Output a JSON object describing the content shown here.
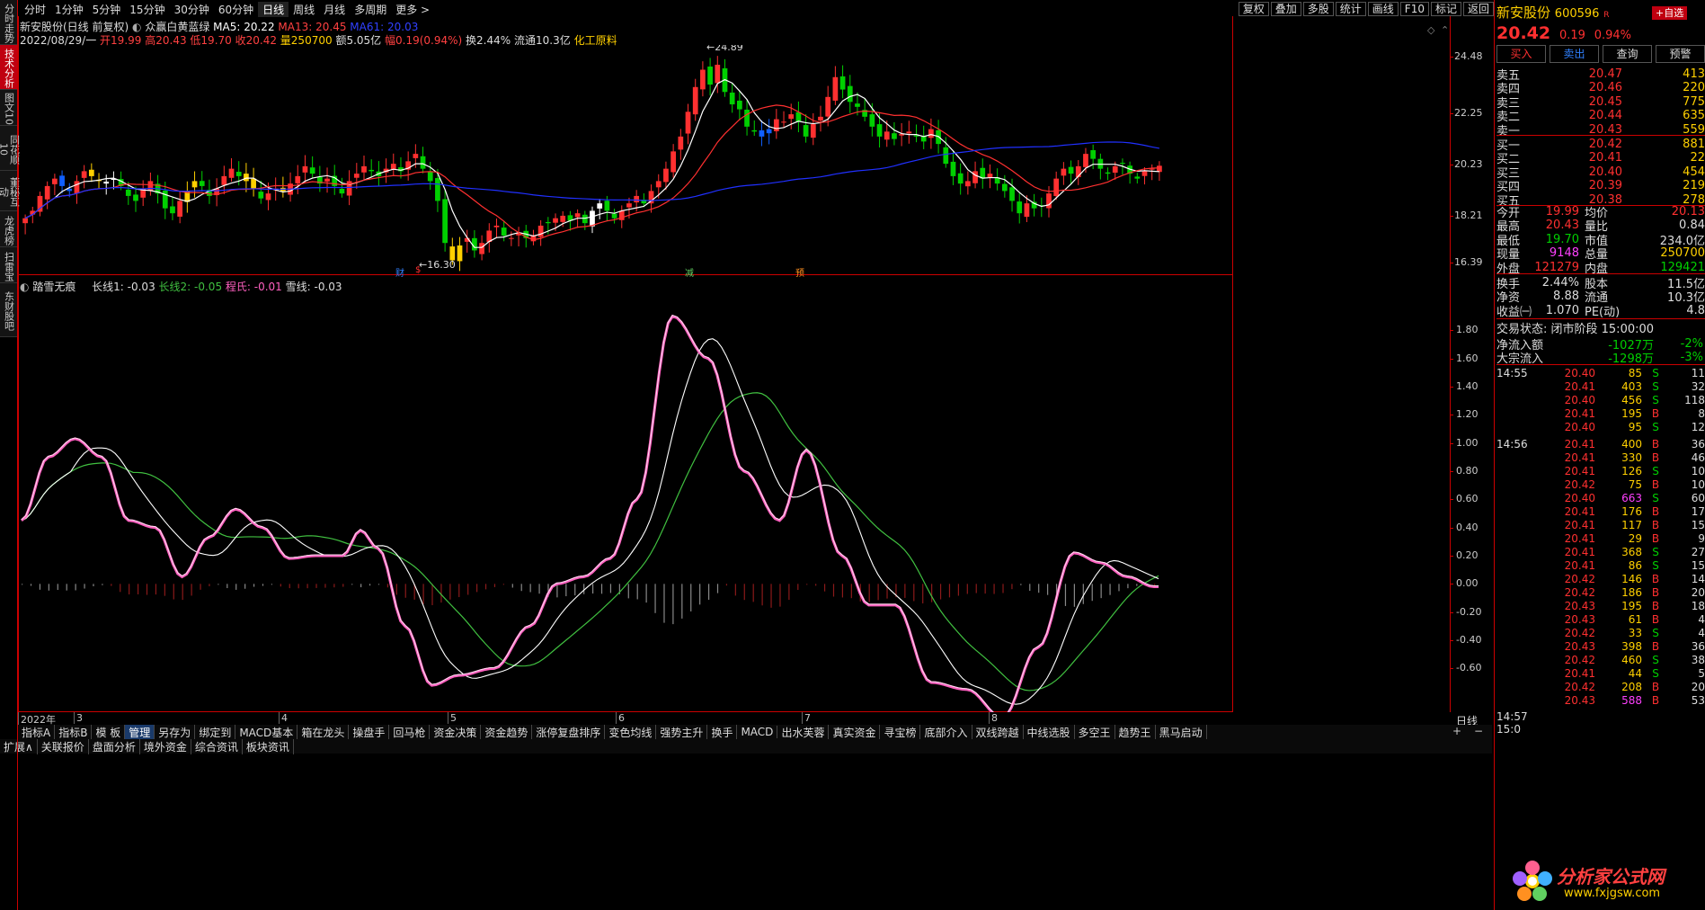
{
  "sidebar": [
    "分时走势",
    "技术分析",
    "图文10",
    "同花顺10",
    "董秘互动",
    "龙虎榜",
    "扫雷宝",
    "东财股吧"
  ],
  "periods": [
    "分时",
    "1分钟",
    "5分钟",
    "15分钟",
    "30分钟",
    "60分钟",
    "日线",
    "周线",
    "月线",
    "多周期",
    "更多"
  ],
  "period_selected": "日线",
  "tools": [
    "复权",
    "叠加",
    "多股",
    "统计",
    "画线",
    "F10",
    "标记",
    "返回"
  ],
  "main_legend": {
    "stock": "新安股份(日线 前复权)",
    "indicator": "众赢白黄蓝绿",
    "ma5": "MA5: 20.22",
    "ma13": "MA13: 20.45",
    "ma61": "MA61: 20.03"
  },
  "day_info": {
    "date": "2022/08/29/一",
    "open": "开19.99",
    "high": "高20.43",
    "low": "低19.70",
    "close": "收20.42",
    "vol": "量250700",
    "amt": "额5.05亿",
    "chg": "幅0.19(0.94%)",
    "turn": "换2.44%",
    "float": "流通10.3亿",
    "sector": "化工原料"
  },
  "price_axis": [
    "24.48",
    "22.25",
    "20.23",
    "18.21",
    "16.39"
  ],
  "price_labels": {
    "high": "24.89",
    "low": "16.30"
  },
  "event_marks": [
    "财",
    "减",
    "预"
  ],
  "sub_legend": {
    "name": "踏雪无痕",
    "l1": "长线1: -0.03",
    "l2": "长线2: -0.05",
    "ch": "程氏: -0.01",
    "xue": "雪线: -0.03"
  },
  "sub_axis": [
    "1.80",
    "1.60",
    "1.40",
    "1.20",
    "1.00",
    "0.80",
    "0.60",
    "0.40",
    "0.20",
    "0.00",
    "-0.20",
    "-0.40",
    "-0.60"
  ],
  "date_axis": [
    "2022年",
    "3",
    "4",
    "5",
    "6",
    "7",
    "8"
  ],
  "period_label": "日线",
  "bottom_tabs": [
    "指标A",
    "指标B",
    "模 板",
    "管理",
    "另存为",
    "绑定到",
    "MACD基本",
    "箱在龙头",
    "操盘手",
    "回马枪",
    "资金决策",
    "资金趋势",
    "涨停复盘排序",
    "变色均线",
    "强势主升",
    "换手",
    "MACD",
    "出水芙蓉",
    "真实资金",
    "寻宝榜",
    "底部介入",
    "双线跨越",
    "中线选股",
    "多空王",
    "趋势王",
    "黑马启动"
  ],
  "bottom_tabs2": [
    "扩展∧",
    "关联报价",
    "盘面分析",
    "境外资金",
    "综合资讯",
    "板块资讯"
  ],
  "quote": {
    "name": "新安股份",
    "code": "600596",
    "code_badge": "R",
    "add": "+自选",
    "price": "20.42",
    "change": "0.19",
    "pct": "0.94%",
    "buttons": [
      "买入",
      "卖出",
      "查询",
      "预警"
    ],
    "asks": [
      {
        "label": "卖五",
        "price": "20.47",
        "vol": "413"
      },
      {
        "label": "卖四",
        "price": "20.46",
        "vol": "220"
      },
      {
        "label": "卖三",
        "price": "20.45",
        "vol": "775"
      },
      {
        "label": "卖二",
        "price": "20.44",
        "vol": "635"
      },
      {
        "label": "卖一",
        "price": "20.43",
        "vol": "559"
      }
    ],
    "bids": [
      {
        "label": "买一",
        "price": "20.42",
        "vol": "881"
      },
      {
        "label": "买二",
        "price": "20.41",
        "vol": "22"
      },
      {
        "label": "买三",
        "price": "20.40",
        "vol": "454"
      },
      {
        "label": "买四",
        "price": "20.39",
        "vol": "219"
      },
      {
        "label": "买五",
        "price": "20.38",
        "vol": "278"
      }
    ],
    "stats": [
      [
        "今开",
        "19.99",
        "均价",
        "20.13"
      ],
      [
        "最高",
        "20.43",
        "量比",
        "0.84"
      ],
      [
        "最低",
        "19.70",
        "市值",
        "234.0亿"
      ],
      [
        "现量",
        "9148",
        "总量",
        "250700"
      ],
      [
        "外盘",
        "121279",
        "内盘",
        "129421"
      ]
    ],
    "stats2": [
      [
        "换手",
        "2.44%",
        "股本",
        "11.5亿"
      ],
      [
        "净资",
        "8.88",
        "流通",
        "10.3亿"
      ],
      [
        "收益㈠",
        "1.070",
        "PE(动)",
        "4.8"
      ]
    ],
    "status": "交易状态: 闭市阶段 15:00:00",
    "flows": [
      [
        "净流入额",
        "-1027万",
        "-2%"
      ],
      [
        "大宗流入",
        "-1298万",
        "-3%"
      ]
    ],
    "ticks": [
      [
        "14:55",
        "20.40",
        "85",
        "S",
        "11"
      ],
      [
        "",
        "20.41",
        "403",
        "S",
        "32"
      ],
      [
        "",
        "20.40",
        "456",
        "S",
        "118"
      ],
      [
        "",
        "20.41",
        "195",
        "B",
        "8"
      ],
      [
        "",
        "20.40",
        "95",
        "S",
        "12"
      ],
      [
        "14:56",
        "20.41",
        "400",
        "B",
        "36"
      ],
      [
        "",
        "20.41",
        "330",
        "B",
        "46"
      ],
      [
        "",
        "20.41",
        "126",
        "S",
        "10"
      ],
      [
        "",
        "20.42",
        "75",
        "B",
        "10"
      ],
      [
        "",
        "20.40",
        "663",
        "S",
        "60"
      ],
      [
        "",
        "20.41",
        "176",
        "B",
        "17"
      ],
      [
        "",
        "20.41",
        "117",
        "B",
        "15"
      ],
      [
        "",
        "20.41",
        "29",
        "B",
        "9"
      ],
      [
        "",
        "20.41",
        "368",
        "S",
        "27"
      ],
      [
        "",
        "20.41",
        "86",
        "S",
        "15"
      ],
      [
        "",
        "20.42",
        "146",
        "B",
        "14"
      ],
      [
        "",
        "20.42",
        "186",
        "B",
        "20"
      ],
      [
        "",
        "20.43",
        "195",
        "B",
        "18"
      ],
      [
        "",
        "20.43",
        "61",
        "B",
        "4"
      ],
      [
        "",
        "20.42",
        "33",
        "S",
        "4"
      ],
      [
        "",
        "20.43",
        "398",
        "B",
        "36"
      ],
      [
        "",
        "20.42",
        "460",
        "S",
        "38"
      ],
      [
        "",
        "20.41",
        "44",
        "S",
        "5"
      ],
      [
        "",
        "20.42",
        "208",
        "B",
        "20"
      ],
      [
        "",
        "20.43",
        "588",
        "B",
        "53"
      ]
    ],
    "last_time": "14:57",
    "last_time2": "15:0"
  },
  "watermark": {
    "title": "分析家公式网",
    "url": "www.fxjgsw.com"
  },
  "colors": {
    "up": "#ff3030",
    "down": "#00d000",
    "ma5": "#ffffff",
    "ma13": "#ff3030",
    "ma61": "#2030ff",
    "yellow": "#ffd000",
    "blue": "#1060ff",
    "pink": "#ff60c0",
    "green": "#40c040"
  }
}
